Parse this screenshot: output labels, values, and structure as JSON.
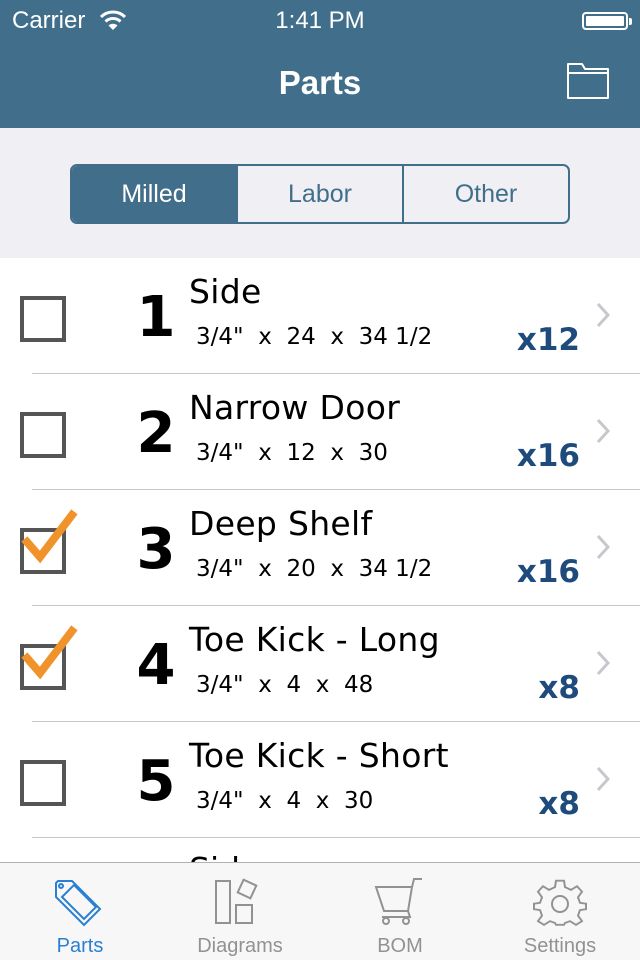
{
  "status_bar": {
    "carrier": "Carrier",
    "time": "1:41 PM",
    "battery_level": 1.0
  },
  "nav": {
    "title": "Parts",
    "right_icon": "folder-icon"
  },
  "segments": [
    {
      "label": "Milled",
      "selected": true
    },
    {
      "label": "Labor",
      "selected": false
    },
    {
      "label": "Other",
      "selected": false
    }
  ],
  "parts": [
    {
      "checked": false,
      "number": "1",
      "name": "Side",
      "thickness": "3/4\"",
      "width": "24",
      "length": "34 1/2",
      "quantity": "x12"
    },
    {
      "checked": false,
      "number": "2",
      "name": "Narrow Door",
      "thickness": "3/4\"",
      "width": "12",
      "length": "30",
      "quantity": "x16"
    },
    {
      "checked": true,
      "number": "3",
      "name": "Deep Shelf",
      "thickness": "3/4\"",
      "width": "20",
      "length": "34 1/2",
      "quantity": "x16"
    },
    {
      "checked": true,
      "number": "4",
      "name": "Toe Kick - Long",
      "thickness": "3/4\"",
      "width": "4",
      "length": "48",
      "quantity": "x8"
    },
    {
      "checked": false,
      "number": "5",
      "name": "Toe Kick - Short",
      "thickness": "3/4\"",
      "width": "4",
      "length": "30",
      "quantity": "x8"
    }
  ],
  "partial_next_row_name": "Side",
  "tabs": [
    {
      "label": "Parts",
      "icon": "tag-icon",
      "active": true
    },
    {
      "label": "Diagrams",
      "icon": "diagrams-icon",
      "active": false
    },
    {
      "label": "BOM",
      "icon": "cart-icon",
      "active": false
    },
    {
      "label": "Settings",
      "icon": "gear-icon",
      "active": false
    }
  ],
  "colors": {
    "nav_bg": "#416f8b",
    "check": "#f0932b",
    "quantity": "#1e4b7c",
    "tab_active": "#2b7fd3",
    "tab_inactive": "#929292"
  }
}
